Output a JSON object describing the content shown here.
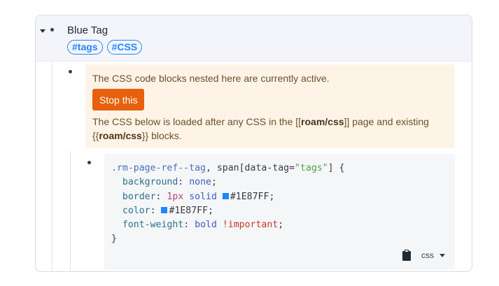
{
  "block": {
    "title": "Blue Tag",
    "tags": [
      "#tags",
      "#CSS"
    ]
  },
  "notice": {
    "line1": "The CSS code blocks nested here are currently active.",
    "stop_label": "Stop this",
    "para_part1": "The CSS below is loaded after any CSS in the [[",
    "para_bold1": "roam/css",
    "para_part2": "]] page and existing {{",
    "para_bold2": "roam/css",
    "para_part3": "}} blocks."
  },
  "code": {
    "l1_selector": ".rm-page-ref--tag",
    "l1_mid": ", span[data-tag=",
    "l1_string": "\"tags\"",
    "l1_end": "] {",
    "l2_prop": "background",
    "l2_value": "none",
    "l3_prop": "border",
    "l3_num": "1px",
    "l3_kw": "solid",
    "l3_color": "#1E87FF",
    "l4_prop": "color",
    "l4_color": "#1E87FF",
    "l5_prop": "font-weight",
    "l5_value": "bold",
    "l5_important": "!important",
    "l6": "}",
    "language": "css",
    "swatch_color": "#1E87FF"
  },
  "icons": {
    "collapse": "caret-down-icon",
    "clipboard": "clipboard-icon",
    "dropdown": "chevron-down-icon"
  },
  "colors": {
    "tag": "#1E87FF",
    "stop_button": "#E8600E",
    "notice_bg": "#FDF4E7"
  }
}
